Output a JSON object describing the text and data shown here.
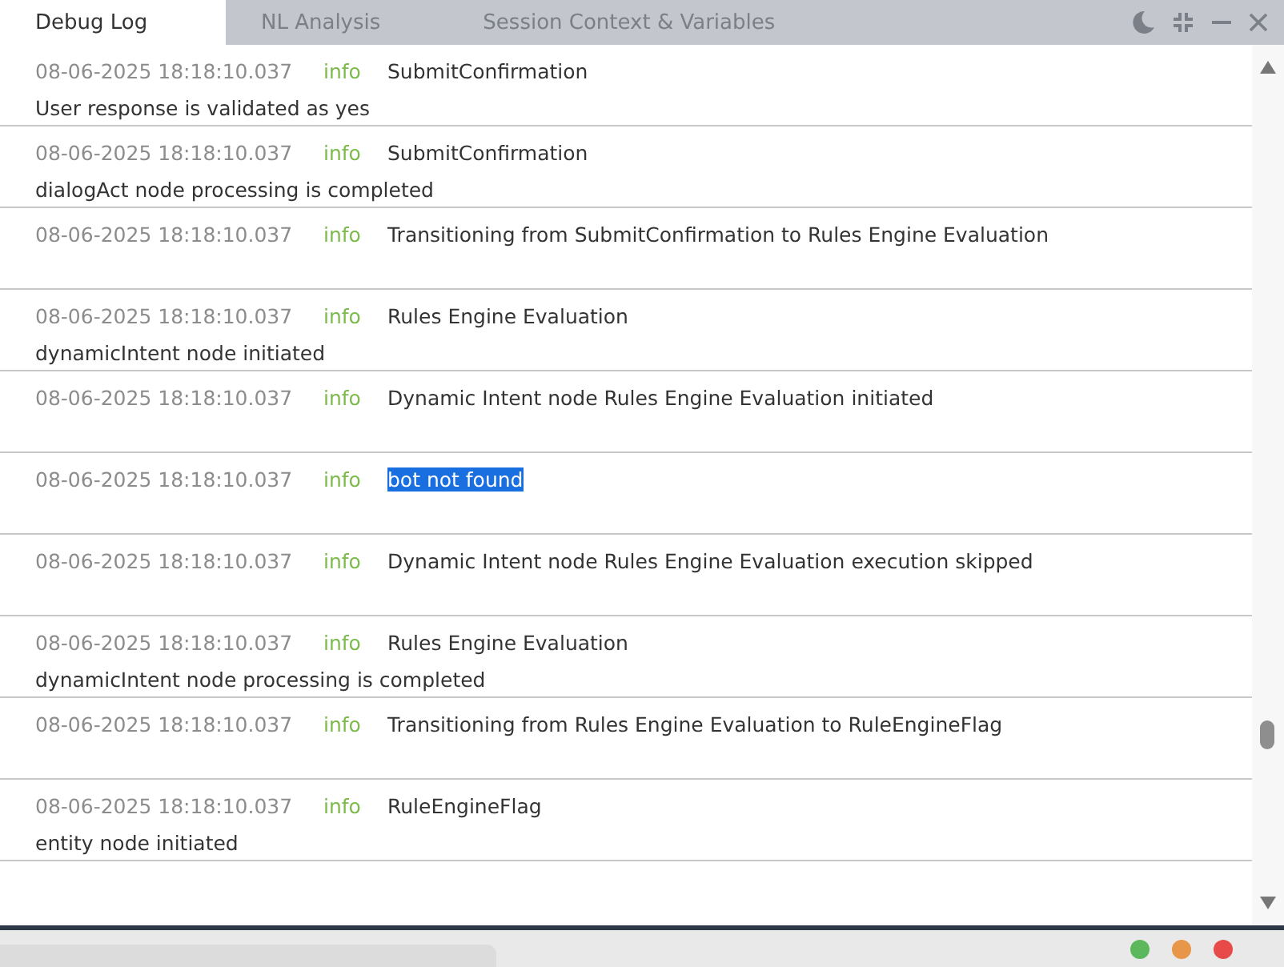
{
  "tabs": [
    {
      "label": "Debug Log",
      "selected": true
    },
    {
      "label": "NL Analysis",
      "selected": false
    },
    {
      "label": "Session Context & Variables",
      "selected": false
    }
  ],
  "log": [
    {
      "time": "08-06-2025 18:18:10.037",
      "level": "info",
      "message": "SubmitConfirmation",
      "detail": "User response is validated as yes",
      "highlighted": false
    },
    {
      "time": "08-06-2025 18:18:10.037",
      "level": "info",
      "message": "SubmitConfirmation",
      "detail": "dialogAct node processing is completed",
      "highlighted": false
    },
    {
      "time": "08-06-2025 18:18:10.037",
      "level": "info",
      "message": "Transitioning from SubmitConfirmation to Rules Engine Evaluation",
      "highlighted": false
    },
    {
      "time": "08-06-2025 18:18:10.037",
      "level": "info",
      "message": "Rules Engine Evaluation",
      "detail": "dynamicIntent node initiated",
      "highlighted": false
    },
    {
      "time": "08-06-2025 18:18:10.037",
      "level": "info",
      "message": "Dynamic Intent node Rules Engine Evaluation initiated",
      "highlighted": false
    },
    {
      "time": "08-06-2025 18:18:10.037",
      "level": "info",
      "message": "bot not found",
      "highlighted": true
    },
    {
      "time": "08-06-2025 18:18:10.037",
      "level": "info",
      "message": "Dynamic Intent node Rules Engine Evaluation execution skipped",
      "highlighted": false
    },
    {
      "time": "08-06-2025 18:18:10.037",
      "level": "info",
      "message": "Rules Engine Evaluation",
      "detail": "dynamicIntent node processing is completed",
      "highlighted": false
    },
    {
      "time": "08-06-2025 18:18:10.037",
      "level": "info",
      "message": "Transitioning from Rules Engine Evaluation to RuleEngineFlag",
      "highlighted": false
    },
    {
      "time": "08-06-2025 18:18:10.037",
      "level": "info",
      "message": "RuleEngineFlag",
      "detail": "entity node initiated",
      "highlighted": false
    }
  ],
  "status_dots": [
    {
      "color": "#5cb85c"
    },
    {
      "color": "#e8964a"
    },
    {
      "color": "#e84a4a"
    }
  ]
}
